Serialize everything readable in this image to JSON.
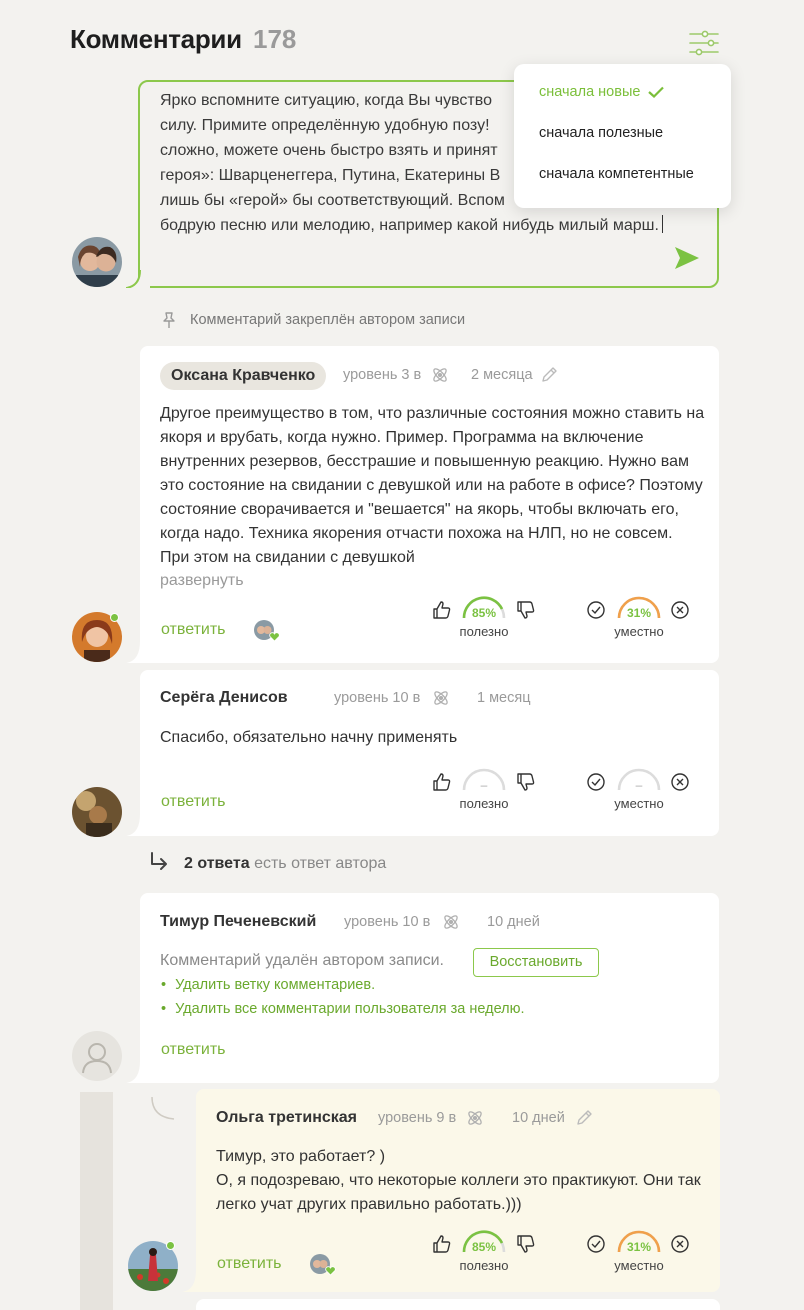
{
  "header": {
    "title": "Комментарии",
    "count": "178",
    "filter_icon": "sliders-icon"
  },
  "sort_menu": {
    "items": [
      {
        "label": "сначала новые",
        "active": true
      },
      {
        "label": "сначала полезные",
        "active": false
      },
      {
        "label": "сначала компетентные",
        "active": false
      }
    ]
  },
  "composer": {
    "text": "Ярко вспомните ситуацию, когда Вы чувство\nсилу. Примите определённую удобную позу!\nсложно, можете очень быстро взять и принят\nгероя»: Шварценеггера, Путина, Екатерины В\nлишь бы «герой» бы соответствующий. Вспом\nбодрую песню или мелодию, например какой нибудь милый марш.",
    "send_icon": "send-icon"
  },
  "pinned_label": "Комментарий закреплён автором записи",
  "comments": [
    {
      "author": "Оксана Кравченко",
      "level": "уровень 3 в",
      "time": "2 месяца",
      "text": "Другое преимущество в том, что различные состояния можно ставить на якоря и врубать, когда нужно. Пример. Программа на включение внутренних резервов, бесстрашие и повышенную реакцию. Нужно вам это состояние на свидании с девушкой или на работе в офисе? Поэтому состояние сворачивается и \"вешается\" на якорь, чтобы включать его, когда надо. Техника якорения отчасти похожа на НЛП, но не совсем. При этом на свидании с девушкой",
      "expand": "развернуть",
      "reply": "ответить",
      "useful": "85%",
      "useful_label": "полезно",
      "relevant": "31%",
      "relevant_label": "уместно"
    },
    {
      "author": "Серёга Денисов",
      "level": "уровень 10 в",
      "time": "1 месяц",
      "text": "Спасибо, обязательно начну применять",
      "reply": "ответить",
      "useful": "–",
      "useful_label": "полезно",
      "relevant": "–",
      "relevant_label": "уместно"
    },
    {
      "author": "Тимур Печеневский",
      "level": "уровень 10 в",
      "time": "10 дней",
      "deleted_text": "Комментарий удалён автором записи.",
      "restore": "Восстановить",
      "links": [
        "Удалить ветку комментариев.",
        "Удалить все комментарии пользователя за неделю."
      ],
      "reply": "ответить"
    },
    {
      "author": "Ольга третинская",
      "level": "уровень 9 в",
      "time": "10 дней",
      "text": "Тимур, это работает? )\nО, я подозреваю, что некоторые коллеги это практикуют. Они так легко учат других правильно работать.)))",
      "reply": "ответить",
      "useful": "85%",
      "useful_label": "полезно",
      "relevant": "31%",
      "relevant_label": "уместно"
    }
  ],
  "replies_toggle": {
    "count": "2 ответа",
    "suffix": "есть ответ автора"
  },
  "colors": {
    "accent": "#8cc84b",
    "useful": "#7bc242",
    "relevant": "#f0a04b",
    "link": "#7bb23b"
  }
}
